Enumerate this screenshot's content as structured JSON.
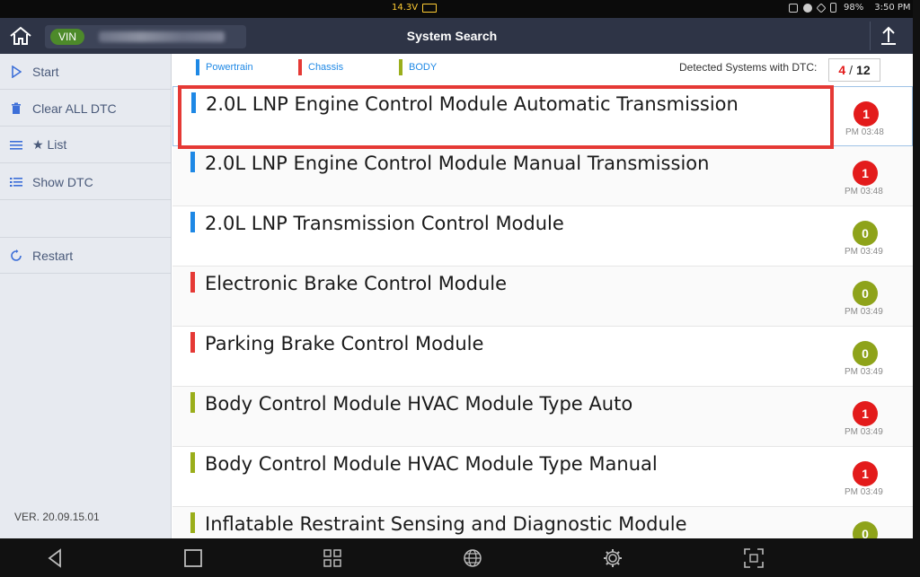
{
  "status_bar": {
    "voltage": "14.3V",
    "battery_percent": "98%",
    "time": "3:50 PM"
  },
  "header": {
    "vin_label": "VIN",
    "title": "System Search"
  },
  "sidebar": {
    "items": [
      {
        "label": "Start",
        "icon": "play-icon"
      },
      {
        "label": "Clear ALL DTC",
        "icon": "trash-icon"
      },
      {
        "label": "★ List",
        "icon": "menu-icon"
      },
      {
        "label": "Show DTC",
        "icon": "list-icon"
      },
      {
        "label": "Restart",
        "icon": "restart-icon"
      }
    ],
    "version": "VER. 20.09.15.01"
  },
  "legend": {
    "items": [
      {
        "label": "Powertrain",
        "color": "#1e88e5"
      },
      {
        "label": "Chassis",
        "color": "#e53935"
      },
      {
        "label": "BODY",
        "color": "#9aae1b"
      }
    ],
    "detected_label": "Detected Systems with DTC:",
    "detected_count": "4",
    "separator": "/",
    "total_count": "12"
  },
  "colors": {
    "powertrain": "#1e88e5",
    "chassis": "#e53935",
    "body": "#9aae1b",
    "dtc_red": "#e31b1b",
    "dtc_green": "#8ea31a"
  },
  "systems": [
    {
      "name": "2.0L LNP Engine Control Module Automatic Transmission",
      "category": "powertrain",
      "dtc": "1",
      "time": "PM 03:48"
    },
    {
      "name": "2.0L LNP Engine Control Module Manual Transmission",
      "category": "powertrain",
      "dtc": "1",
      "time": "PM 03:48"
    },
    {
      "name": "2.0L LNP Transmission Control Module",
      "category": "powertrain",
      "dtc": "0",
      "time": "PM 03:49"
    },
    {
      "name": "Electronic Brake Control Module",
      "category": "chassis",
      "dtc": "0",
      "time": "PM 03:49"
    },
    {
      "name": "Parking Brake Control Module",
      "category": "chassis",
      "dtc": "0",
      "time": "PM 03:49"
    },
    {
      "name": "Body Control Module HVAC Module Type Auto",
      "category": "body",
      "dtc": "1",
      "time": "PM 03:49"
    },
    {
      "name": "Body Control Module HVAC Module Type Manual",
      "category": "body",
      "dtc": "1",
      "time": "PM 03:49"
    },
    {
      "name": "Inflatable Restraint Sensing and Diagnostic Module",
      "category": "body",
      "dtc": "0",
      "time": ""
    }
  ]
}
